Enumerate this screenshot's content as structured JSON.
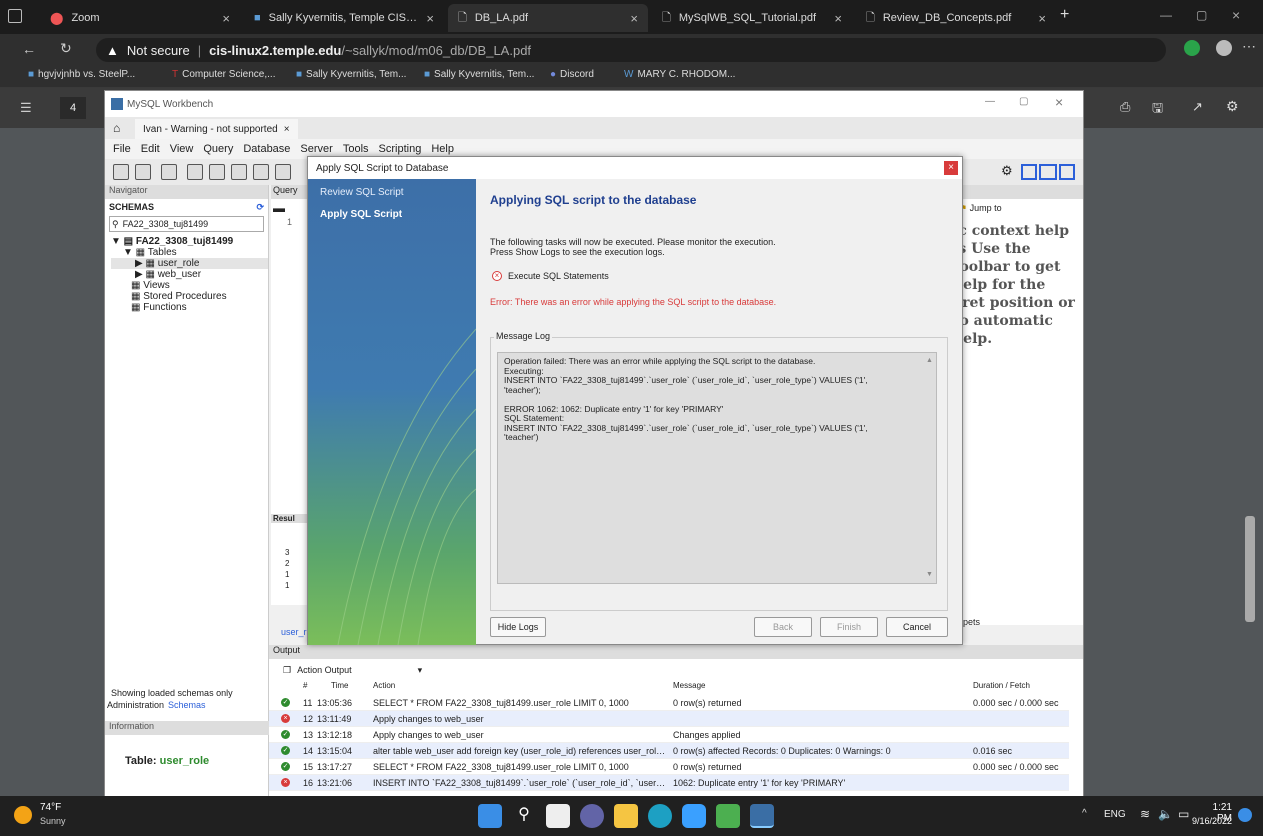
{
  "browser": {
    "tabs": [
      {
        "label": "Zoom"
      },
      {
        "label": "Sally Kyvernitis, Temple CIS Depa"
      },
      {
        "label": "DB_LA.pdf"
      },
      {
        "label": "MySqlWB_SQL_Tutorial.pdf"
      },
      {
        "label": "Review_DB_Concepts.pdf"
      }
    ],
    "security": "Not secure",
    "url_host": "cis-linux2.temple.edu",
    "url_path": "/~sallyk/mod/m06_db/DB_LA.pdf",
    "bookmarks": [
      "hgvjvjnhb vs. SteelP...",
      "Computer Science,...",
      "Sally Kyvernitis, Tem...",
      "Sally Kyvernitis, Tem...",
      "Discord",
      "MARY C. RHODOM..."
    ]
  },
  "pdf": {
    "page_number": "4"
  },
  "workbench": {
    "title": "MySQL Workbench",
    "connection_tab": "Ivan - Warning - not supported",
    "menu": [
      "File",
      "Edit",
      "View",
      "Query",
      "Database",
      "Server",
      "Tools",
      "Scripting",
      "Help"
    ],
    "navigator_label": "Navigator",
    "schemas_label": "SCHEMAS",
    "filter_value": "FA22_3308_tuj81499",
    "schema_name": "FA22_3308_tuj81499",
    "tree": {
      "tables": "Tables",
      "items": [
        "user_role",
        "web_user"
      ],
      "views": "Views",
      "procedures": "Stored Procedures",
      "functions": "Functions"
    },
    "showing_loaded": "Showing loaded schemas only",
    "tab_admin": "Administration",
    "tab_schemas": "Schemas",
    "information_label": "Information",
    "info_table_prefix": "Table:",
    "info_table_name": "user_role",
    "query_tab": "Query",
    "line_number": "1",
    "result_label": "Resul",
    "result_rows": [
      "3",
      "2",
      "1",
      "1"
    ],
    "bottom_tab": "user_r",
    "jump_to": "Jump to",
    "context_help": "ic context help is Use the toolbar to get help for the aret position or to automatic help.",
    "snippets": "nippets",
    "output_label": "Output",
    "action_output": "Action Output",
    "columns": {
      "num": "#",
      "time": "Time",
      "action": "Action",
      "message": "Message",
      "duration": "Duration / Fetch"
    },
    "output_rows": [
      {
        "num": "11",
        "time": "13:05:36",
        "action": "SELECT * FROM FA22_3308_tuj81499.user_role LIMIT 0, 1000",
        "message": "0 row(s) returned",
        "duration": "0.000 sec / 0.000 sec",
        "status": "ok"
      },
      {
        "num": "12",
        "time": "13:11:49",
        "action": "Apply changes to web_user",
        "message": "",
        "duration": "",
        "status": "error"
      },
      {
        "num": "13",
        "time": "13:12:18",
        "action": "Apply changes to web_user",
        "message": "Changes applied",
        "duration": "",
        "status": "ok"
      },
      {
        "num": "14",
        "time": "13:15:04",
        "action": "alter table web_user add foreign key (user_role_id) references user_role (...",
        "message": "0 row(s) affected Records: 0  Duplicates: 0  Warnings: 0",
        "duration": "0.016 sec",
        "status": "ok"
      },
      {
        "num": "15",
        "time": "13:17:27",
        "action": "SELECT * FROM FA22_3308_tuj81499.user_role LIMIT 0, 1000",
        "message": "0 row(s) returned",
        "duration": "0.000 sec / 0.000 sec",
        "status": "ok"
      },
      {
        "num": "16",
        "time": "13:21:06",
        "action": "INSERT INTO `FA22_3308_tuj81499`.`user_role` (`user_role_id`, `user_ro...",
        "message": "1062: Duplicate entry '1' for key 'PRIMARY'",
        "duration": "",
        "status": "error"
      }
    ]
  },
  "dialog": {
    "title": "Apply SQL Script to Database",
    "step1": "Review SQL Script",
    "step2": "Apply SQL Script",
    "heading": "Applying SQL script to the database",
    "desc1": "The following tasks will now be executed. Please monitor the execution.",
    "desc2": "Press Show Logs to see the execution logs.",
    "task": "Execute SQL Statements",
    "error": "Error: There was an error while applying the SQL script to the database.",
    "log_label": "Message Log",
    "log_lines": [
      "Operation failed: There was an error while applying the SQL script to the database.",
      "Executing:",
      "INSERT INTO `FA22_3308_tuj81499`.`user_role` (`user_role_id`, `user_role_type`) VALUES ('1',",
      "'teacher');",
      "",
      "ERROR 1062: 1062: Duplicate entry '1' for key 'PRIMARY'",
      "SQL Statement:",
      "INSERT INTO `FA22_3308_tuj81499`.`user_role` (`user_role_id`, `user_role_type`) VALUES ('1',",
      "'teacher')"
    ],
    "hide_logs": "Hide Logs",
    "back": "Back",
    "finish": "Finish",
    "cancel": "Cancel"
  },
  "taskbar": {
    "weather_temp": "74°F",
    "weather_desc": "Sunny",
    "lang": "ENG",
    "time": "1:21 PM",
    "date": "9/16/2022"
  },
  "colors": {
    "error_red": "#d83b3b",
    "accent_blue": "#1f3f8f",
    "green": "#2e8b2e"
  }
}
